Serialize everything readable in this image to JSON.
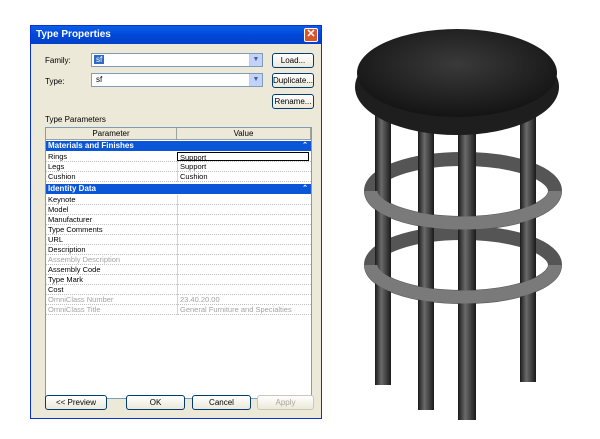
{
  "window": {
    "title": "Type Properties",
    "close": "✕"
  },
  "family": {
    "label": "Family:",
    "value": "sf"
  },
  "type": {
    "label": "Type:",
    "value": "sf"
  },
  "buttons": {
    "load": "Load...",
    "duplicate": "Duplicate...",
    "rename": "Rename...",
    "preview": "<< Preview",
    "ok": "OK",
    "cancel": "Cancel",
    "apply": "Apply"
  },
  "section_label": "Type Parameters",
  "columns": {
    "parameter": "Parameter",
    "value": "Value"
  },
  "groups": [
    {
      "title": "Materials and Finishes",
      "toggle": "⌃",
      "rows": [
        {
          "p": "Rings",
          "v": "Support"
        },
        {
          "p": "Legs",
          "v": "Support"
        },
        {
          "p": "Cushion",
          "v": "Cushion"
        }
      ]
    },
    {
      "title": "Identity Data",
      "toggle": "⌃",
      "rows": [
        {
          "p": "Keynote",
          "v": ""
        },
        {
          "p": "Model",
          "v": ""
        },
        {
          "p": "Manufacturer",
          "v": ""
        },
        {
          "p": "Type Comments",
          "v": ""
        },
        {
          "p": "URL",
          "v": ""
        },
        {
          "p": "Description",
          "v": ""
        },
        {
          "p": "Assembly Description",
          "v": ""
        },
        {
          "p": "Assembly Code",
          "v": ""
        },
        {
          "p": "Type Mark",
          "v": ""
        },
        {
          "p": "Cost",
          "v": ""
        },
        {
          "p": "OmniClass Number",
          "v": "23.40.20.00"
        },
        {
          "p": "OmniClass Title",
          "v": "General Furniture and Specialties"
        }
      ]
    }
  ],
  "colors": {
    "title_bar": "#0a5ee6",
    "group_header": "#0b56d6",
    "stool": "#3a3a3a"
  }
}
